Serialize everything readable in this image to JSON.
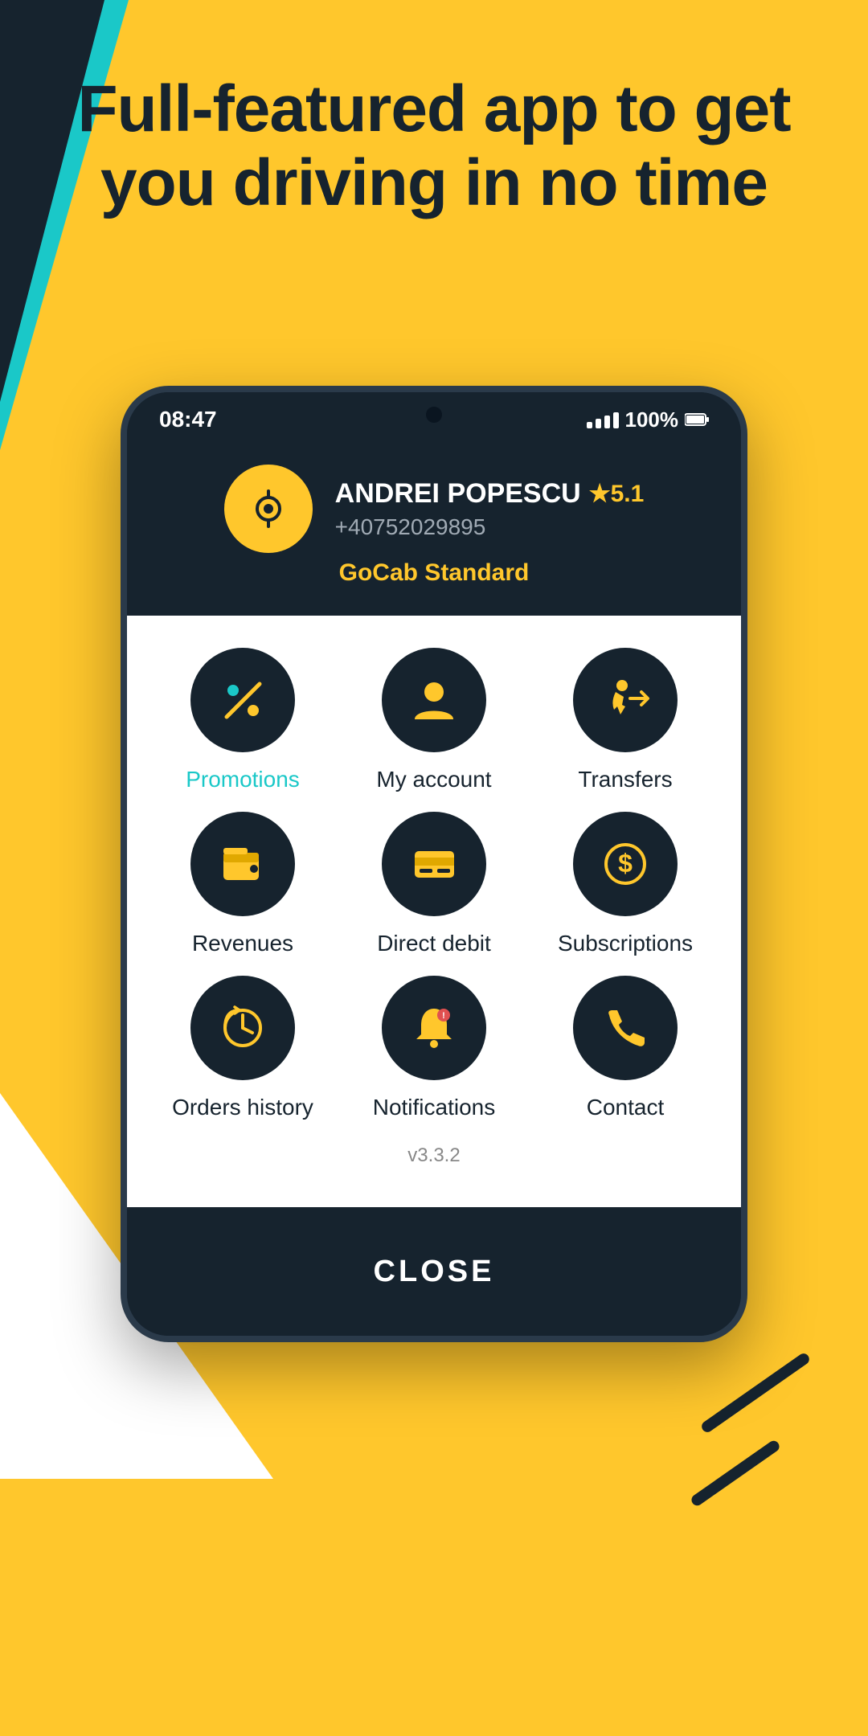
{
  "headline": "Full-featured app to get you driving in no time",
  "status": {
    "time": "08:47",
    "signal": "100%",
    "battery": "100%"
  },
  "profile": {
    "name": "ANDREI POPESCU",
    "rating": "5.1",
    "phone": "+40752029895",
    "plan": "GoCab Standard"
  },
  "menu": {
    "items": [
      {
        "id": "promotions",
        "label": "Promotions",
        "active": true,
        "icon": "percent"
      },
      {
        "id": "my-account",
        "label": "My account",
        "active": false,
        "icon": "person"
      },
      {
        "id": "transfers",
        "label": "Transfers",
        "active": false,
        "icon": "transfer"
      },
      {
        "id": "revenues",
        "label": "Revenues",
        "active": false,
        "icon": "wallet"
      },
      {
        "id": "direct-debit",
        "label": "Direct debit",
        "active": false,
        "icon": "card"
      },
      {
        "id": "subscriptions",
        "label": "Subscriptions",
        "active": false,
        "icon": "dollar"
      },
      {
        "id": "orders-history",
        "label": "Orders history",
        "active": false,
        "icon": "history"
      },
      {
        "id": "notifications",
        "label": "Notifications",
        "active": false,
        "icon": "bell"
      },
      {
        "id": "contact",
        "label": "Contact",
        "active": false,
        "icon": "phone"
      }
    ]
  },
  "version": "v3.3.2",
  "close_label": "CLOSE"
}
